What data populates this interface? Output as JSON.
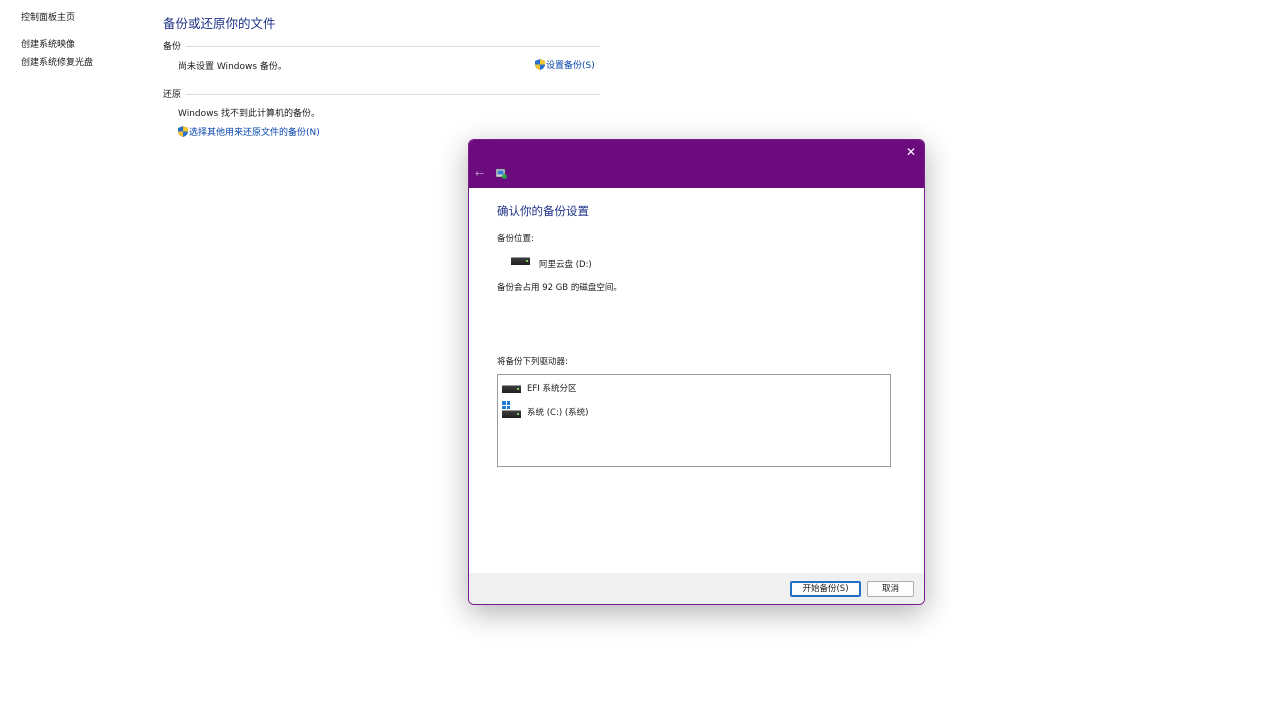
{
  "sidebar": {
    "items": [
      {
        "label": "控制面板主页"
      },
      {
        "label": "创建系统映像"
      },
      {
        "label": "创建系统修复光盘"
      }
    ]
  },
  "main": {
    "title": "备份或还原你的文件",
    "backup": {
      "header": "备份",
      "status": "尚未设置 Windows 备份。",
      "setup_link": "设置备份(S)"
    },
    "restore": {
      "header": "还原",
      "status": "Windows 找不到此计算机的备份。",
      "select_link": "选择其他用来还原文件的备份(N)"
    }
  },
  "dialog": {
    "heading": "确认你的备份设置",
    "location_label": "备份位置:",
    "location_drive": "阿里云盘 (D:)",
    "space_text": "备份会占用 92 GB 的磁盘空间。",
    "drives_label": "将备份下列驱动器:",
    "drives": [
      {
        "name": "EFI 系统分区",
        "icon": "drive-icon"
      },
      {
        "name": "系统 (C:) (系统)",
        "icon": "windows-drive-icon"
      }
    ],
    "start_button": "开始备份(S)",
    "cancel_button": "取消",
    "close_glyph": "✕",
    "back_glyph": "←"
  },
  "colors": {
    "titlebar": "#6b0b7d",
    "heading": "#1e3287",
    "link": "#0645ad"
  }
}
